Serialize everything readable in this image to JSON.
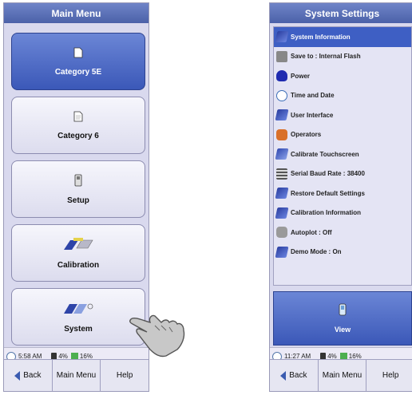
{
  "left": {
    "title": "Main Menu",
    "buttons": [
      {
        "label": "Category 5E",
        "icon": "document-icon",
        "active": true
      },
      {
        "label": "Category 6",
        "icon": "document-icon",
        "active": false
      },
      {
        "label": "Setup",
        "icon": "device-icon",
        "active": false
      },
      {
        "label": "Calibration",
        "icon": "calibration-icon",
        "active": false
      },
      {
        "label": "System",
        "icon": "system-icon",
        "active": false
      }
    ],
    "status": {
      "time": "5:58 AM",
      "battery": "4%",
      "signal": "16%"
    },
    "nav": {
      "back": "Back",
      "main_menu": "Main Menu",
      "help": "Help"
    }
  },
  "right": {
    "title": "System Settings",
    "items": [
      {
        "label": "System Information",
        "icon": "book-icon",
        "selected": true
      },
      {
        "label": "Save to : Internal Flash",
        "icon": "disk-icon",
        "selected": false
      },
      {
        "label": "Power",
        "icon": "power-icon",
        "selected": false
      },
      {
        "label": "Time and Date",
        "icon": "clock-icon",
        "selected": false
      },
      {
        "label": "User Interface",
        "icon": "book-icon",
        "selected": false
      },
      {
        "label": "Operators",
        "icon": "operators-icon",
        "selected": false
      },
      {
        "label": "Calibrate Touchscreen",
        "icon": "calibrate-icon",
        "selected": false
      },
      {
        "label": "Serial Baud Rate : 38400",
        "icon": "serial-icon",
        "selected": false
      },
      {
        "label": "Restore Default Settings",
        "icon": "book-icon",
        "selected": false
      },
      {
        "label": "Calibration Information",
        "icon": "book-icon",
        "selected": false
      },
      {
        "label": "Autoplot : Off",
        "icon": "autoplot-icon",
        "selected": false
      },
      {
        "label": "Demo Mode : On",
        "icon": "book-icon",
        "selected": false
      }
    ],
    "view_label": "View",
    "status": {
      "time": "11:27 AM",
      "battery": "4%",
      "signal": "16%"
    },
    "nav": {
      "back": "Back",
      "main_menu": "Main Menu",
      "help": "Help"
    }
  },
  "colors": {
    "accent": "#3e5fc4",
    "titlebar": "#4b61a8",
    "panel": "#d9d9ee"
  }
}
